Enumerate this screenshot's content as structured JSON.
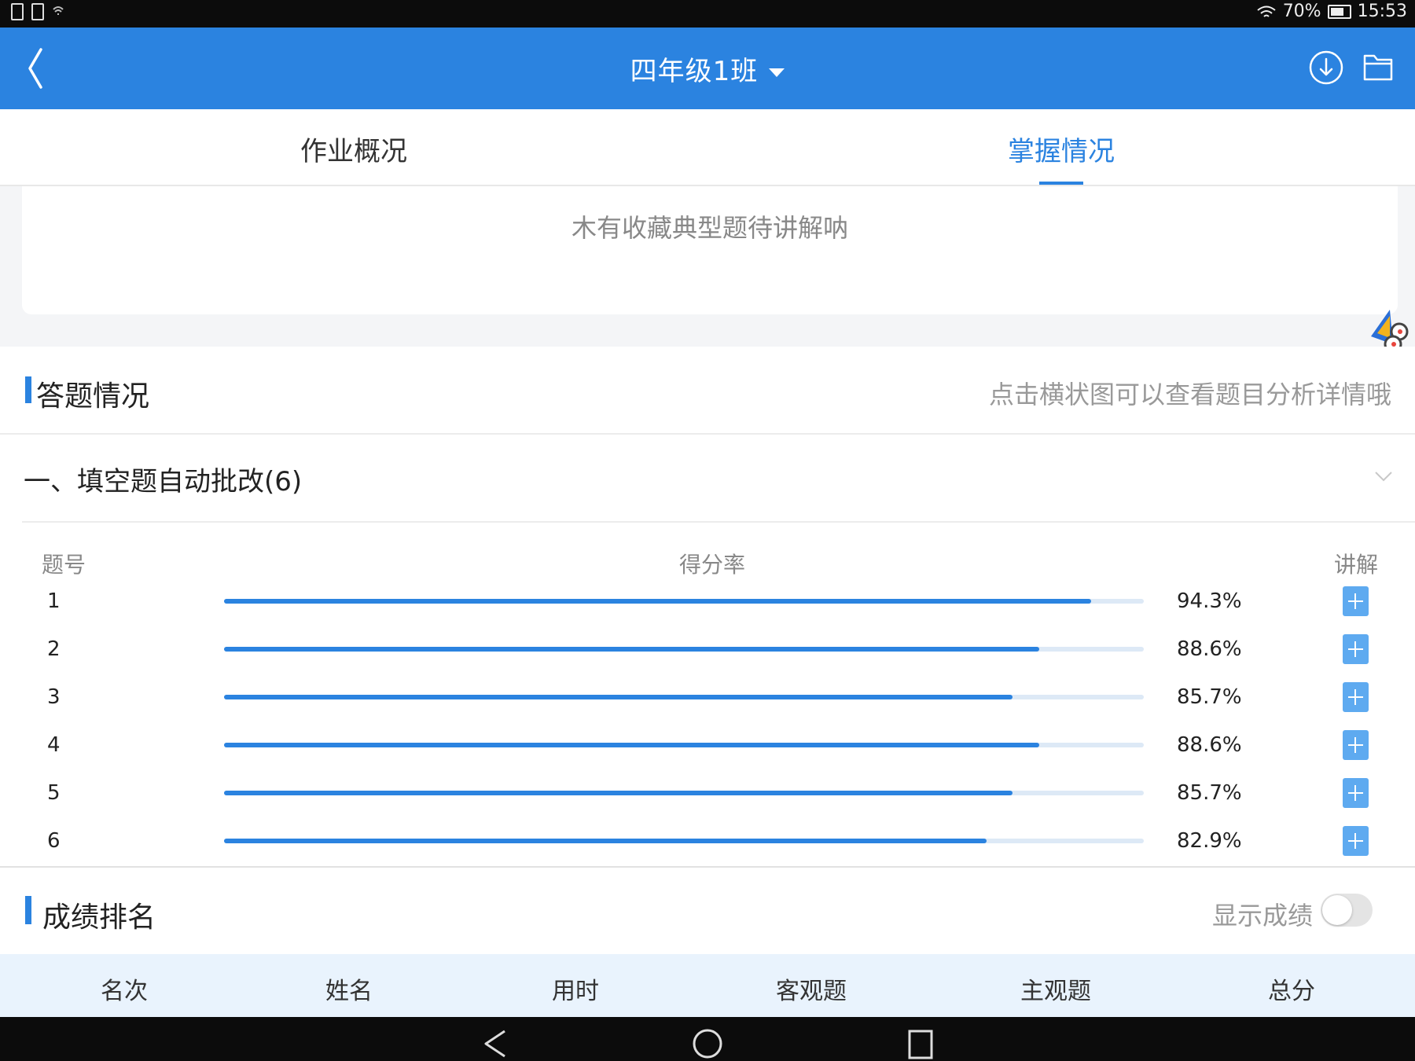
{
  "status_bar": {
    "battery": "70%",
    "time": "15:53"
  },
  "header": {
    "title": "四年级1班"
  },
  "tabs": [
    {
      "label": "作业概况",
      "active": false
    },
    {
      "label": "掌握情况",
      "active": true
    }
  ],
  "empty_state": {
    "text": "木有收藏典型题待讲解呐"
  },
  "answers_section": {
    "title": "答题情况",
    "hint": "点击横状图可以查看题目分析详情哦"
  },
  "group": {
    "title": "一、填空题自动批改(6)"
  },
  "table": {
    "col_num": "题号",
    "col_rate": "得分率",
    "col_explain": "讲解",
    "rows": [
      {
        "num": "1",
        "rate_label": "94.3%",
        "rate": 0.943
      },
      {
        "num": "2",
        "rate_label": "88.6%",
        "rate": 0.886
      },
      {
        "num": "3",
        "rate_label": "85.7%",
        "rate": 0.857
      },
      {
        "num": "4",
        "rate_label": "88.6%",
        "rate": 0.886
      },
      {
        "num": "5",
        "rate_label": "85.7%",
        "rate": 0.857
      },
      {
        "num": "6",
        "rate_label": "82.9%",
        "rate": 0.829
      }
    ]
  },
  "ranking": {
    "title": "成绩排名",
    "toggle_label": "显示成绩",
    "toggle_on": false,
    "columns": [
      "名次",
      "姓名",
      "用时",
      "客观题",
      "主观题",
      "总分"
    ]
  },
  "colors": {
    "primary": "#2b83e0",
    "track": "#dde9f6",
    "plus": "#5eaaf0"
  }
}
